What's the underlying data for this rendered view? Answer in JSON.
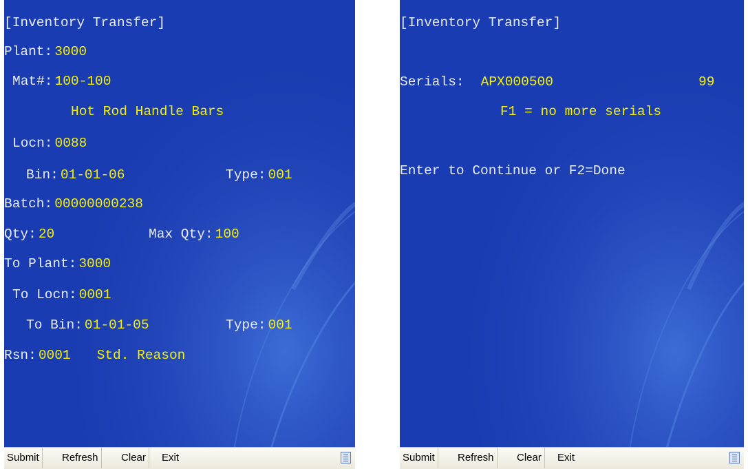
{
  "left_screen": {
    "title": "[Inventory Transfer]",
    "plant_label": "Plant:",
    "plant_value": "3000",
    "mat_label": "Mat#:",
    "mat_value": "100-100",
    "description": "Hot Rod Handle Bars",
    "locn_label": "Locn:",
    "locn_value": "0088",
    "bin_label": "Bin:",
    "bin_value": "01-01-06",
    "type_label": "Type:",
    "type_value": "001",
    "batch_label": "Batch:",
    "batch_value": "00000000238",
    "qty_label": "Qty:",
    "qty_value": "20",
    "max_qty_label": "Max Qty:",
    "max_qty_value": "100",
    "to_plant_label": "To Plant:",
    "to_plant_value": "3000",
    "to_locn_label": "To Locn:",
    "to_locn_value": "0001",
    "to_bin_label": "To Bin:",
    "to_bin_value": "01-01-05",
    "to_type_label": "Type:",
    "to_type_value": "001",
    "rsn_label": "Rsn:",
    "rsn_value": "0001",
    "rsn_text": "Std. Reason"
  },
  "right_screen": {
    "title": "[Inventory Transfer]",
    "serials_label": "Serials:",
    "serials_value": "APX000500",
    "serials_count": "99",
    "f1_hint": "F1 = no more serials",
    "continue_prompt": "Enter to Continue or F2=Done"
  },
  "toolbar": {
    "submit_label": "Submit",
    "refresh_label": "Refresh",
    "clear_label": "Clear",
    "exit_label": "Exit",
    "menu_icon": "list-icon"
  },
  "colors": {
    "screen_bg": "#1a3fb4",
    "label": "#e8ecf6",
    "value": "#f4f000",
    "toolbar_bg": "#ece8dc"
  }
}
